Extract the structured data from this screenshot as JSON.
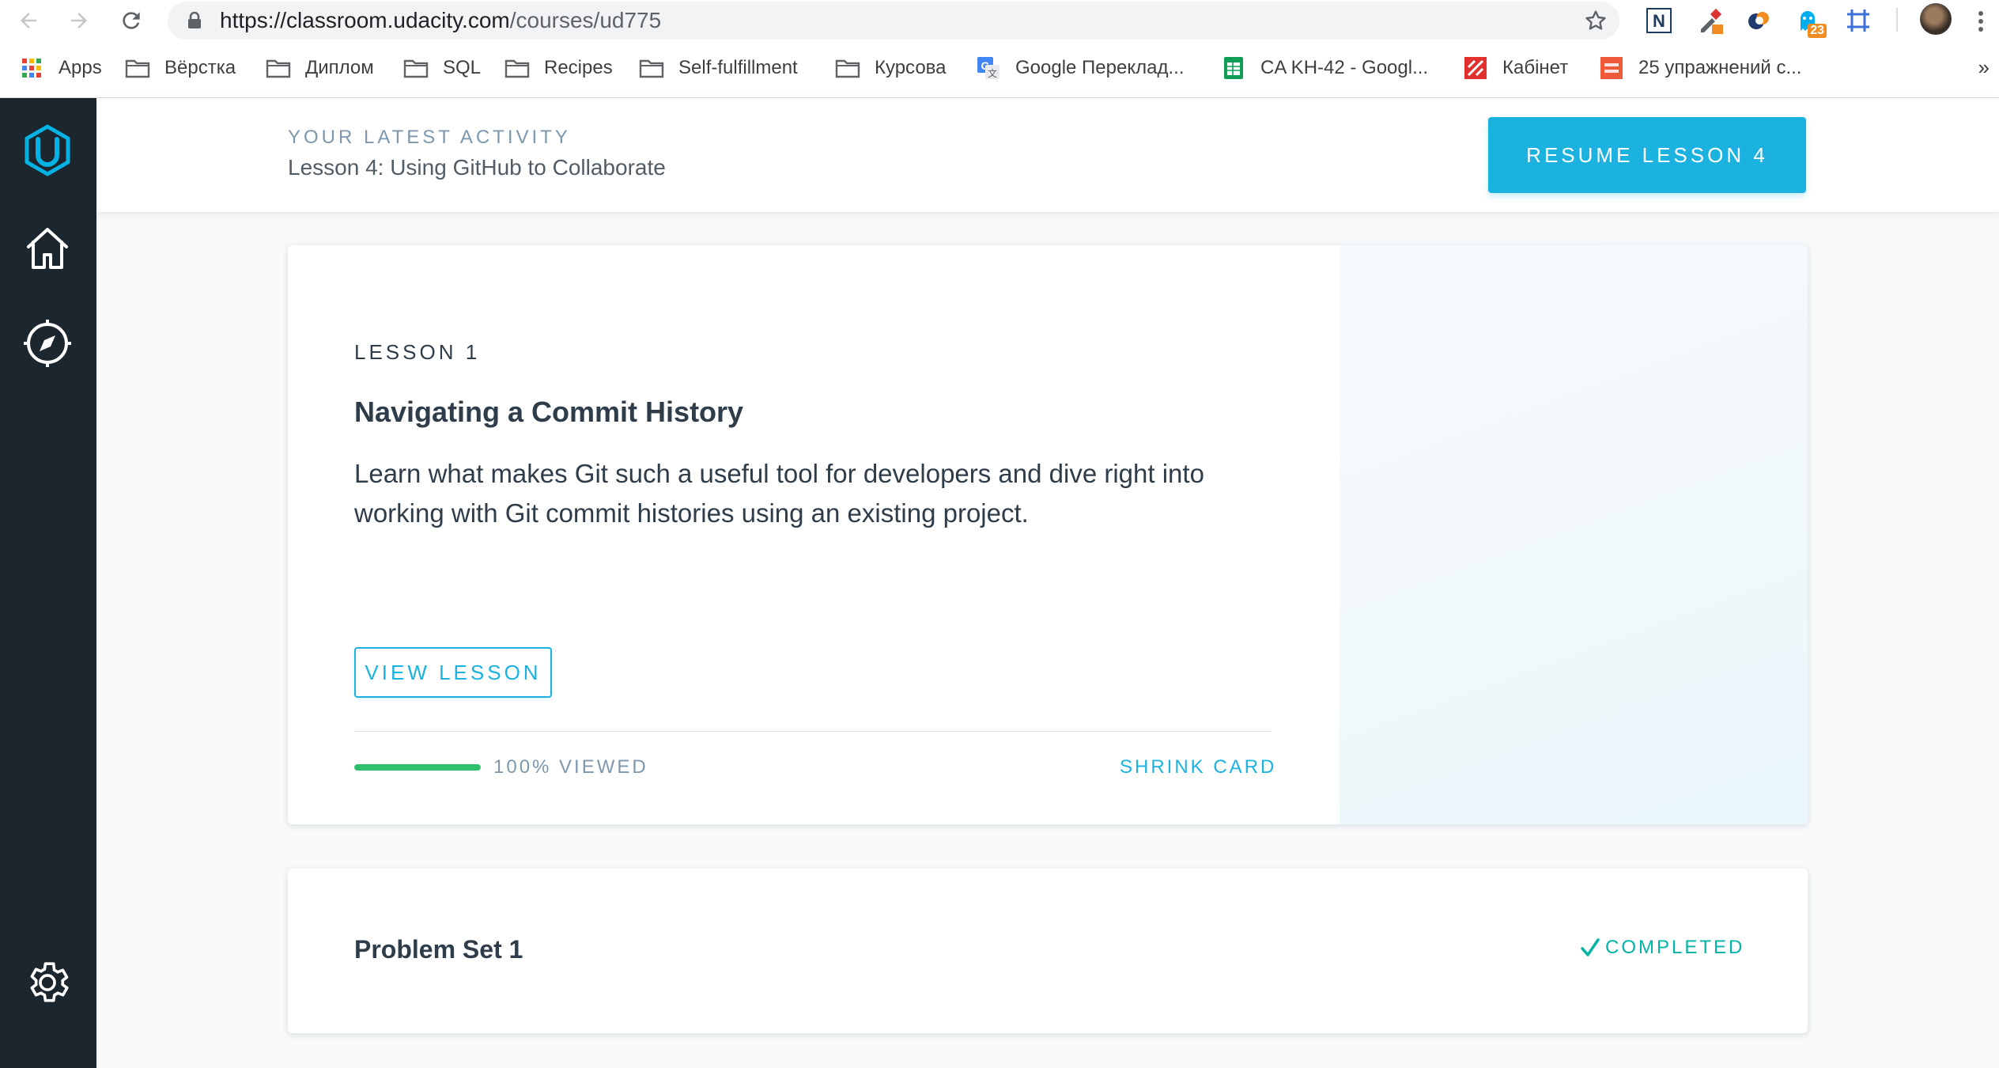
{
  "browser": {
    "url_host": "https://classroom.udacity.com",
    "url_path": "/courses/ud775",
    "extensions": [
      {
        "name": "notion-web-clipper-icon"
      },
      {
        "name": "color-picker-icon"
      },
      {
        "name": "lastpass-like-icon"
      },
      {
        "name": "ghostery-icon",
        "badge": "23"
      },
      {
        "name": "screen-ruler-icon"
      }
    ]
  },
  "bookmarks": [
    {
      "label": "Apps",
      "icon": "apps-grid-icon"
    },
    {
      "label": "Вёрстка",
      "icon": "folder-icon"
    },
    {
      "label": "Диплом",
      "icon": "folder-icon"
    },
    {
      "label": "SQL",
      "icon": "folder-icon"
    },
    {
      "label": "Recipes",
      "icon": "folder-icon"
    },
    {
      "label": "Self-fulfillment",
      "icon": "folder-icon"
    },
    {
      "label": "Курсова",
      "icon": "folder-icon"
    },
    {
      "label": "Google Переклад...",
      "icon": "google-translate-icon"
    },
    {
      "label": "CA KH-42 - Googl...",
      "icon": "google-sheets-icon"
    },
    {
      "label": "Кабінет",
      "icon": "cabinet-site-icon"
    },
    {
      "label": "25 упражнений с...",
      "icon": "lifehacker-icon"
    }
  ],
  "bookmarks_overflow": "»",
  "sidebar": {
    "items": [
      {
        "name": "udacity-logo-icon"
      },
      {
        "name": "home-icon"
      },
      {
        "name": "explore-compass-icon"
      },
      {
        "name": "settings-gear-icon"
      }
    ]
  },
  "activity": {
    "kicker": "YOUR LATEST ACTIVITY",
    "lesson_title": "Lesson 4: Using GitHub to Collaborate",
    "resume_label": "RESUME LESSON 4"
  },
  "lesson_card": {
    "lesson_number": "LESSON 1",
    "title": "Navigating a Commit History",
    "description": "Learn what makes Git such a useful tool for developers and dive right into working with Git commit histories using an existing project.",
    "view_label": "VIEW LESSON",
    "progress_percent": 100,
    "progress_label": "100% VIEWED",
    "shrink_label": "SHRINK CARD"
  },
  "problem_set": {
    "title": "Problem Set 1",
    "status": "COMPLETED"
  },
  "colors": {
    "accent": "#1cb2e0",
    "sidebar_bg": "#1c262f",
    "progress": "#2dbf6c",
    "completed": "#02b3a6",
    "page_bg": "#f7f9fa"
  }
}
